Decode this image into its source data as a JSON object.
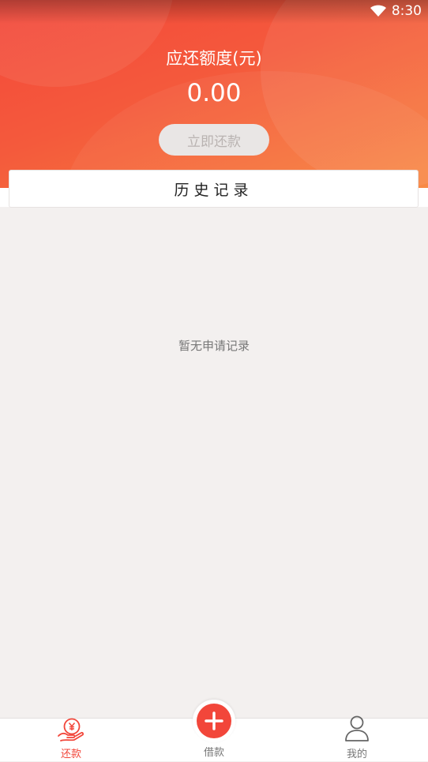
{
  "status_bar": {
    "time": "8:30",
    "wifi_icon": "wifi-icon"
  },
  "header": {
    "title": "应还额度(元)",
    "amount": "0.00",
    "repay_button": "立即还款"
  },
  "history": {
    "title": "历史记录",
    "empty_text": "暂无申请记录"
  },
  "tabbar": {
    "items": [
      {
        "label": "还款",
        "icon": "repay-yen-hand-icon",
        "active": true
      },
      {
        "label": "借款",
        "icon": "plus-icon",
        "active": false
      },
      {
        "label": "我的",
        "icon": "person-icon",
        "active": false
      }
    ]
  },
  "colors": {
    "accent": "#f2463a",
    "header_gradient_start": "#f3473a",
    "header_gradient_end": "#f8843d",
    "background": "#f3f0ef"
  }
}
